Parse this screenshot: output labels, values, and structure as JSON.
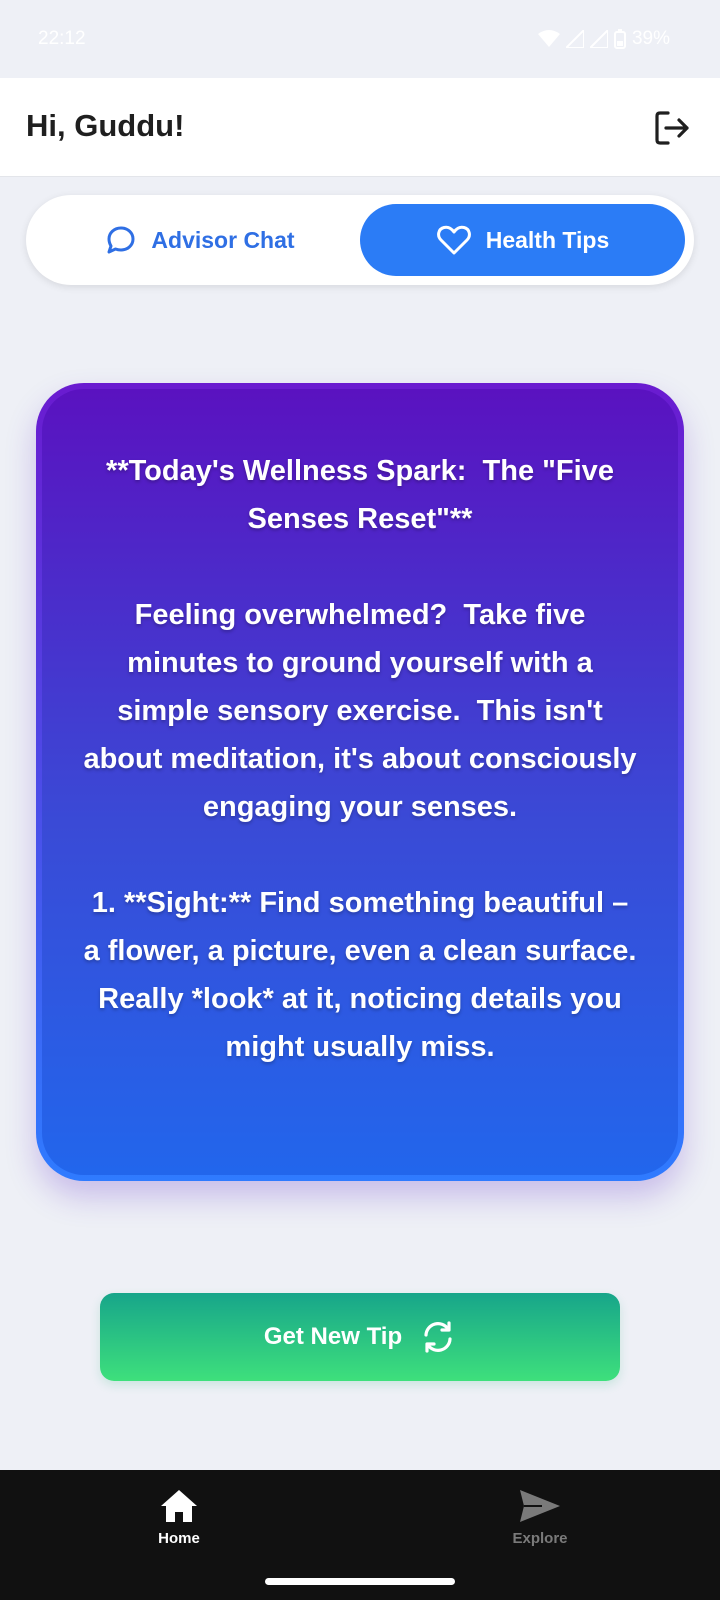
{
  "status_bar": {
    "time": "22:12",
    "battery": "39%"
  },
  "header": {
    "greeting": "Hi, Guddu!",
    "logout_icon": "logout-icon"
  },
  "tabs": [
    {
      "label": "Advisor Chat",
      "icon": "chat-bubble-icon",
      "active": false
    },
    {
      "label": "Health Tips",
      "icon": "heart-icon",
      "active": true
    }
  ],
  "tip": {
    "text": "**Today's Wellness Spark:  The \"Five Senses Reset\"**\n\nFeeling overwhelmed?  Take five minutes to ground yourself with a simple sensory exercise.  This isn't about meditation, it's about consciously engaging your senses.\n\n1. **Sight:** Find something beautiful – a flower, a picture, even a clean surface.  Really *look* at it, noticing details you might usually miss."
  },
  "new_tip_button": {
    "label": "Get New Tip",
    "icon": "refresh-icon"
  },
  "bottom_nav": [
    {
      "label": "Home",
      "icon": "home-icon",
      "active": true
    },
    {
      "label": "Explore",
      "icon": "send-icon",
      "active": false
    }
  ],
  "colors": {
    "accent": "#2b7cf6",
    "card_top": "#5a12c0",
    "card_bottom": "#2266ec",
    "button_top": "#17a58a",
    "button_bottom": "#3ee07c",
    "nav_bg": "#111111"
  }
}
